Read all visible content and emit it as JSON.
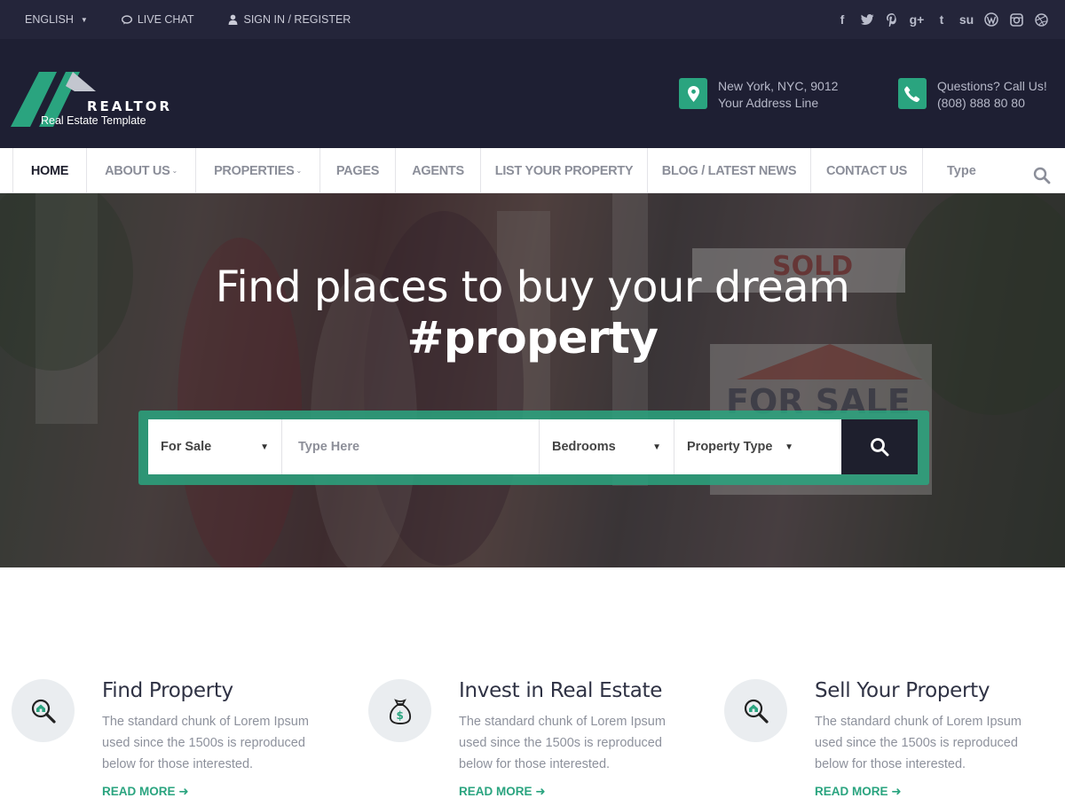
{
  "topbar": {
    "language": "ENGLISH",
    "live_chat": "LIVE CHAT",
    "sign_in": "SIGN IN / REGISTER",
    "socials": [
      {
        "icon": "facebook-icon",
        "glyph": "f"
      },
      {
        "icon": "twitter-icon",
        "glyph": "t"
      },
      {
        "icon": "pinterest-icon",
        "glyph": "p"
      },
      {
        "icon": "google-plus-icon",
        "glyph": "g+"
      },
      {
        "icon": "tumblr-icon",
        "glyph": "t"
      },
      {
        "icon": "stumbleupon-icon",
        "glyph": "su"
      },
      {
        "icon": "wordpress-icon",
        "glyph": "W"
      },
      {
        "icon": "instagram-icon",
        "glyph": "◎"
      },
      {
        "icon": "dribbble-icon",
        "glyph": "⊕"
      }
    ]
  },
  "header": {
    "logo_name": "REALTOR",
    "logo_tagline": "Real Estate Template",
    "address_line1": "New York, NYC, 9012",
    "address_line2": "Your Address Line",
    "phone_line1": "Questions? Call Us!",
    "phone_line2": "(808) 888 80 80"
  },
  "nav": {
    "items": [
      {
        "label": "HOME",
        "active": true
      },
      {
        "label": "ABOUT US",
        "dropdown": true
      },
      {
        "label": "PROPERTIES",
        "dropdown": true
      },
      {
        "label": "PAGES"
      },
      {
        "label": "AGENTS"
      },
      {
        "label": "LIST YOUR PROPERTY"
      },
      {
        "label": "BLOG / LATEST NEWS"
      },
      {
        "label": "CONTACT US"
      }
    ],
    "search_placeholder": "Type"
  },
  "hero": {
    "title": "Find places to buy your dream",
    "subtitle": "#property",
    "search": {
      "status": "For Sale",
      "keyword_placeholder": "Type Here",
      "bedrooms": "Bedrooms",
      "property_type": "Property Type"
    }
  },
  "features": [
    {
      "icon": "home-search-icon",
      "title": "Find Property",
      "desc": "The standard chunk of Lorem Ipsum used since the 1500s is reproduced below for those interested.",
      "more": "READ MORE"
    },
    {
      "icon": "money-bag-icon",
      "title": "Invest in Real Estate",
      "desc": "The standard chunk of Lorem Ipsum used since the 1500s is reproduced below for those interested.",
      "more": "READ MORE"
    },
    {
      "icon": "home-search-icon",
      "title": "Sell Your Property",
      "desc": "The standard chunk of Lorem Ipsum used since the 1500s is reproduced below for those interested.",
      "more": "READ MORE"
    }
  ],
  "colors": {
    "accent": "#2aa47f",
    "dark": "#1e1f33",
    "topbar": "#24253a"
  }
}
